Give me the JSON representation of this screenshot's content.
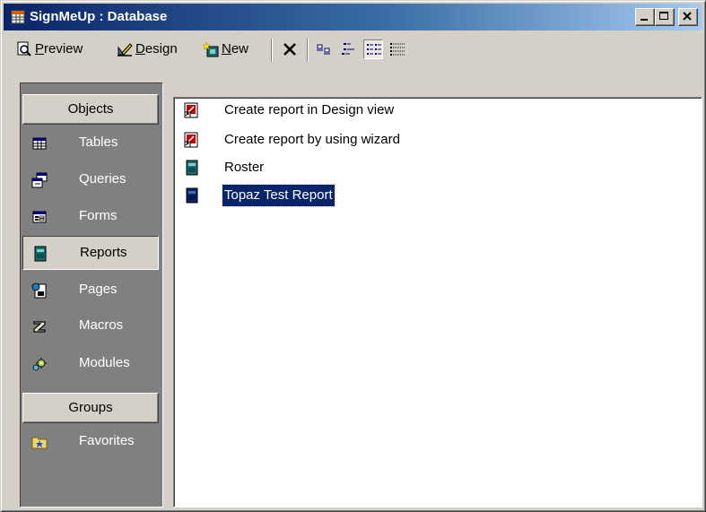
{
  "window": {
    "title": "SignMeUp : Database"
  },
  "caption_buttons": [
    "minimize",
    "maximize",
    "close"
  ],
  "toolbar": {
    "preview": {
      "underline": "P",
      "rest": "review"
    },
    "design": {
      "underline": "D",
      "rest": "esign"
    },
    "new": {
      "underline": "N",
      "rest": "ew"
    },
    "delete_icon": "delete-x-icon",
    "view_modes": [
      "large-icons",
      "small-icons",
      "list",
      "details"
    ],
    "active_view": "list"
  },
  "objects_bar": {
    "objects_header": "Objects",
    "items": [
      {
        "label": "Tables",
        "icon": "table-icon"
      },
      {
        "label": "Queries",
        "icon": "query-icon"
      },
      {
        "label": "Forms",
        "icon": "form-icon"
      },
      {
        "label": "Reports",
        "icon": "report-icon",
        "selected": true
      },
      {
        "label": "Pages",
        "icon": "page-icon"
      },
      {
        "label": "Macros",
        "icon": "macro-icon"
      },
      {
        "label": "Modules",
        "icon": "module-icon"
      }
    ],
    "groups_header": "Groups",
    "groups": [
      {
        "label": "Favorites",
        "icon": "favorites-folder-icon"
      }
    ]
  },
  "report_list": [
    {
      "label": "Create report in Design view",
      "icon": "design-shortcut-icon"
    },
    {
      "label": "Create report by using wizard",
      "icon": "wizard-shortcut-icon"
    },
    {
      "label": "Roster",
      "icon": "report-icon"
    },
    {
      "label": "Topaz Test Report",
      "icon": "report-icon",
      "selected": true
    }
  ],
  "colors": {
    "titlebar_start": "#0a246a",
    "titlebar_end": "#a6caf0",
    "face": "#d4d0c8",
    "objects_bg": "#808080",
    "selection": "#0a246a"
  }
}
